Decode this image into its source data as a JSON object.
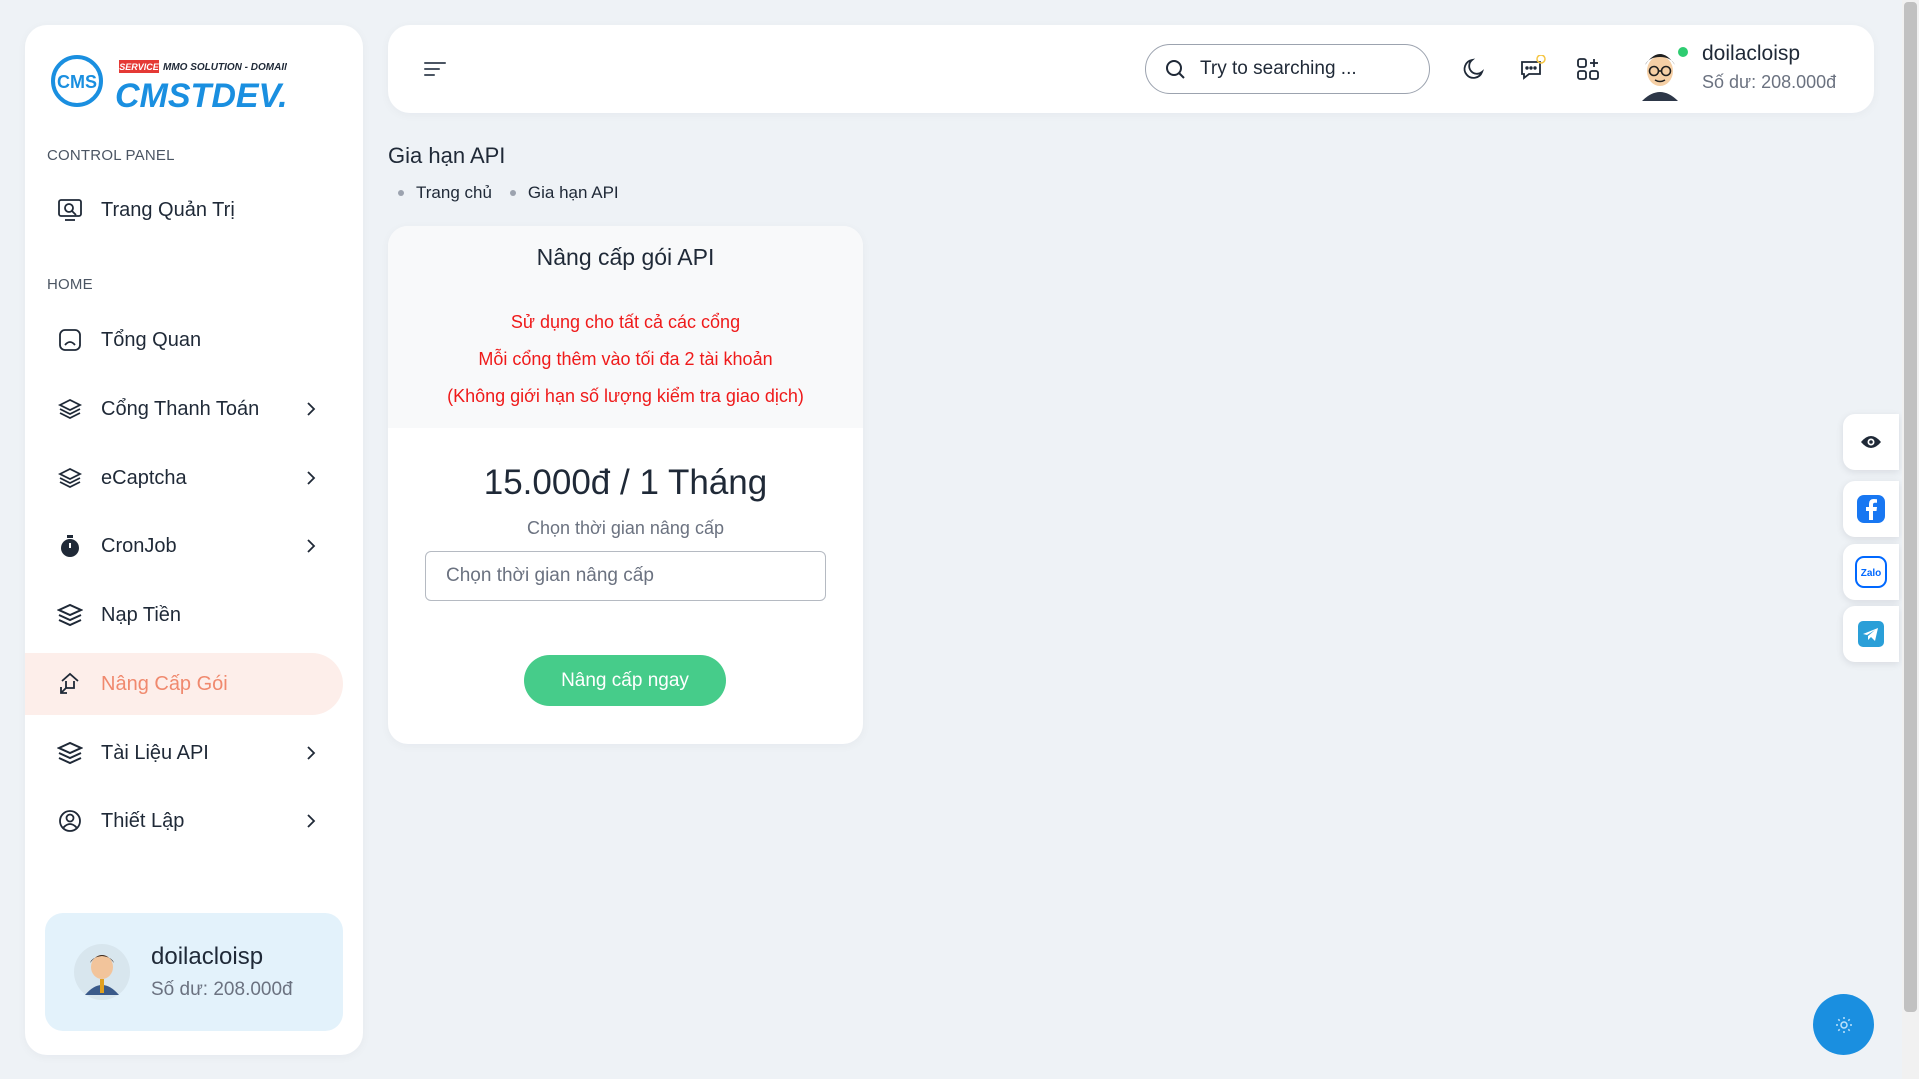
{
  "brand": {
    "logo_mark": "CMS",
    "logo_tagline": "SERVICE MMO SOLUTION - DOMAIN",
    "logo_text": "CMSTDEV.VN"
  },
  "sidebar": {
    "section_control": "CONTROL PANEL",
    "section_home": "HOME",
    "items": [
      {
        "label": "Trang Quản Trị",
        "icon": "admin-monitor-icon",
        "has_chevron": false
      },
      {
        "label": "Tổng Quan",
        "icon": "overview-icon",
        "has_chevron": false
      },
      {
        "label": "Cổng Thanh Toán",
        "icon": "layers-icon",
        "has_chevron": true
      },
      {
        "label": "eCaptcha",
        "icon": "layers-icon",
        "has_chevron": true
      },
      {
        "label": "CronJob",
        "icon": "stopwatch-icon",
        "has_chevron": true
      },
      {
        "label": "Nạp Tiền",
        "icon": "stack-icon",
        "has_chevron": false
      },
      {
        "label": "Nâng Cấp Gói",
        "icon": "upgrade-arrows-icon",
        "has_chevron": false,
        "active": true
      },
      {
        "label": "Tài Liệu API",
        "icon": "stack-icon",
        "has_chevron": true
      },
      {
        "label": "Thiết Lập",
        "icon": "user-circle-icon",
        "has_chevron": true
      }
    ],
    "user_card": {
      "name": "doilacloisp",
      "balance": "Số dư: 208.000đ"
    }
  },
  "header": {
    "search_placeholder": "Try to searching ...",
    "user_name": "doilacloisp",
    "user_balance": "Số dư: 208.000đ",
    "icons": [
      "menu-icon",
      "search-icon",
      "moon-icon",
      "chat-icon",
      "apps-icon"
    ]
  },
  "page": {
    "title": "Gia hạn API",
    "breadcrumb": [
      "Trang chủ",
      "Gia hạn API"
    ]
  },
  "card": {
    "title": "Nâng cấp gói API",
    "features": [
      "Sử dụng cho tất cả các cổng",
      "Mỗi cổng thêm vào tối đa 2 tài khoản",
      "(Không giới hạn số lượng kiểm tra giao dịch)"
    ],
    "price": "15.000đ / 1 Tháng",
    "choose_label": "Chọn thời gian nâng cấp",
    "choose_placeholder": "Chọn thời gian nâng cấp",
    "button": "Nâng cấp ngay"
  },
  "float_buttons": [
    "eye-icon",
    "facebook-icon",
    "zalo-icon",
    "telegram-icon"
  ],
  "colors": {
    "accent_active": "#f0896e",
    "active_bg": "#fdeeea",
    "button_green": "#46cc8a",
    "feature_red": "#ef1a1a",
    "online": "#2ecc71",
    "fab_blue": "#1a8fe0"
  }
}
